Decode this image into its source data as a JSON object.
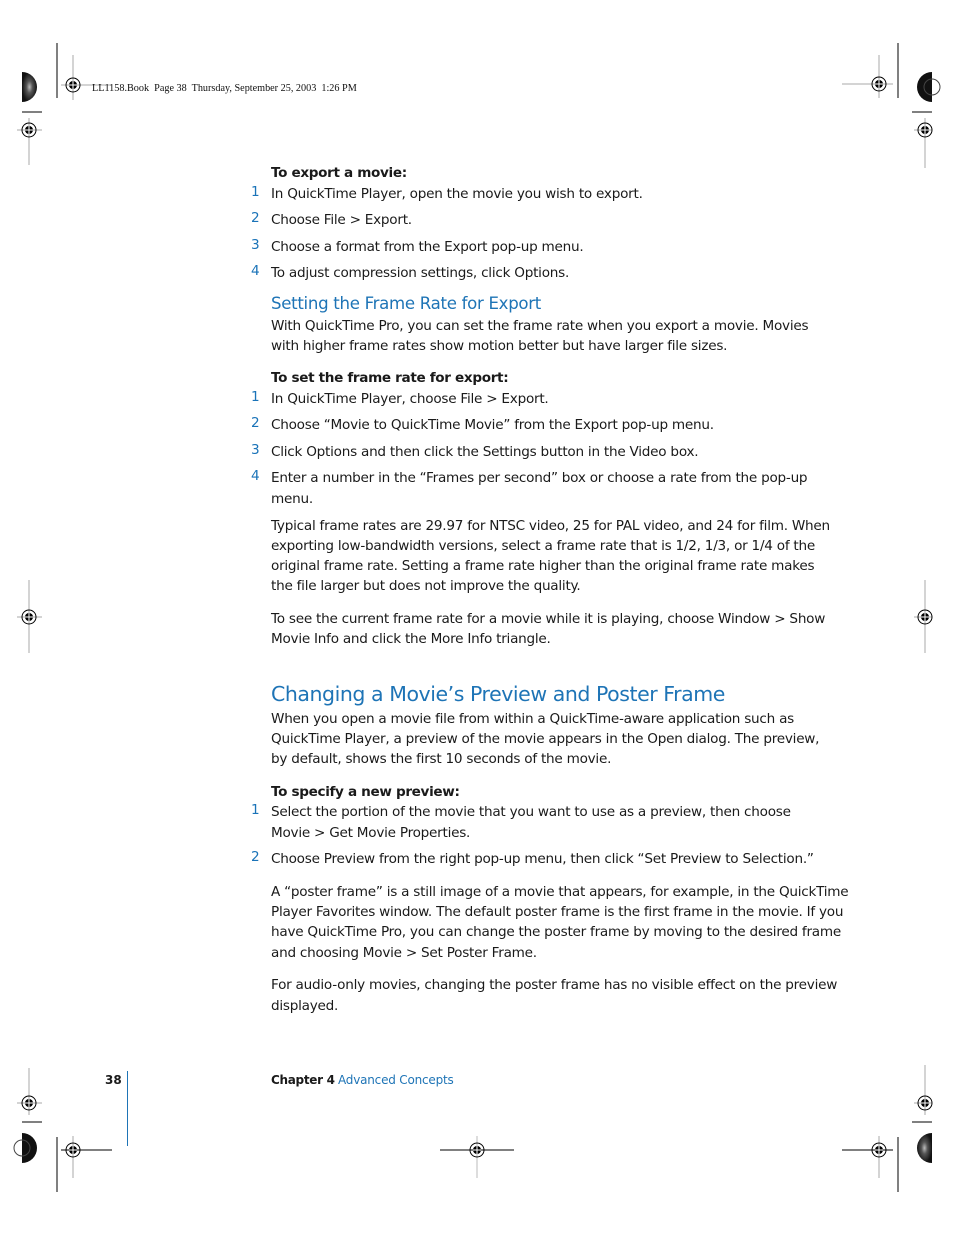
{
  "slug": "LL1158.Book  Page 38  Thursday, September 25, 2003  1:26 PM",
  "sections": {
    "export_movie": {
      "task_heading": "To export a movie:",
      "steps": [
        {
          "num": "1",
          "text": "In QuickTime Player, open the movie you wish to export."
        },
        {
          "num": "2",
          "text": "Choose File > Export."
        },
        {
          "num": "3",
          "text": "Choose a format from the Export pop-up menu."
        },
        {
          "num": "4",
          "text": "To adjust compression settings, click Options."
        }
      ]
    },
    "frame_rate": {
      "heading": "Setting the Frame Rate for Export",
      "intro": [
        "With QuickTime Pro, you can set the frame rate when you export a movie. Movies",
        "with higher frame rates show motion better but have larger file sizes."
      ],
      "task_heading": "To set the frame rate for export:",
      "steps": [
        {
          "num": "1",
          "lines": [
            "In QuickTime Player, choose File > Export."
          ]
        },
        {
          "num": "2",
          "lines": [
            "Choose “Movie to QuickTime Movie” from the Export pop-up menu."
          ]
        },
        {
          "num": "3",
          "lines": [
            "Click Options and then click the Settings button in the Video box."
          ]
        },
        {
          "num": "4",
          "lines": [
            "Enter a number in the “Frames per second” box or choose a rate from the pop-up",
            "menu."
          ]
        }
      ],
      "note1": [
        "Typical frame rates are 29.97 for NTSC video, 25 for PAL video, and 24 for film. When",
        "exporting low-bandwidth versions, select a frame rate that is 1/2, 1/3, or 1/4 of the",
        "original frame rate. Setting a frame rate higher than the original frame rate makes",
        "the file larger but does not improve the quality."
      ],
      "note2": [
        "To see the current frame rate for a movie while it is playing, choose Window > Show",
        "Movie Info and click the More Info triangle."
      ]
    },
    "preview_poster": {
      "heading": "Changing a Movie’s Preview and Poster Frame",
      "intro": [
        "When you open a movie file from within a QuickTime-aware application such as",
        "QuickTime Player, a preview of the movie appears in the Open dialog. The preview,",
        "by default, shows the first 10 seconds of the movie."
      ],
      "task_heading": "To specify a new preview:",
      "steps": [
        {
          "num": "1",
          "lines": [
            "Select the portion of the movie that you want to use as a preview, then choose",
            "Movie > Get Movie Properties."
          ]
        },
        {
          "num": "2",
          "lines": [
            "Choose Preview from the right pop-up menu, then click “Set Preview to Selection.”"
          ]
        }
      ],
      "para1": [
        "A “poster frame” is a still image of a movie that appears, for example, in the QuickTime",
        "Player Favorites window. The default poster frame is the first frame in the movie. If you",
        "have QuickTime Pro, you can change the poster frame by moving to the desired frame",
        "and choosing Movie > Set Poster Frame."
      ],
      "para2": [
        "For audio-only movies, changing the poster frame has no visible effect on the preview",
        "displayed."
      ]
    }
  },
  "footer": {
    "page_number": "38",
    "chapter_label": "Chapter 4",
    "chapter_title": "Advanced Concepts"
  },
  "colors": {
    "accent": "#1e74b6",
    "text": "#1a1a1a"
  }
}
